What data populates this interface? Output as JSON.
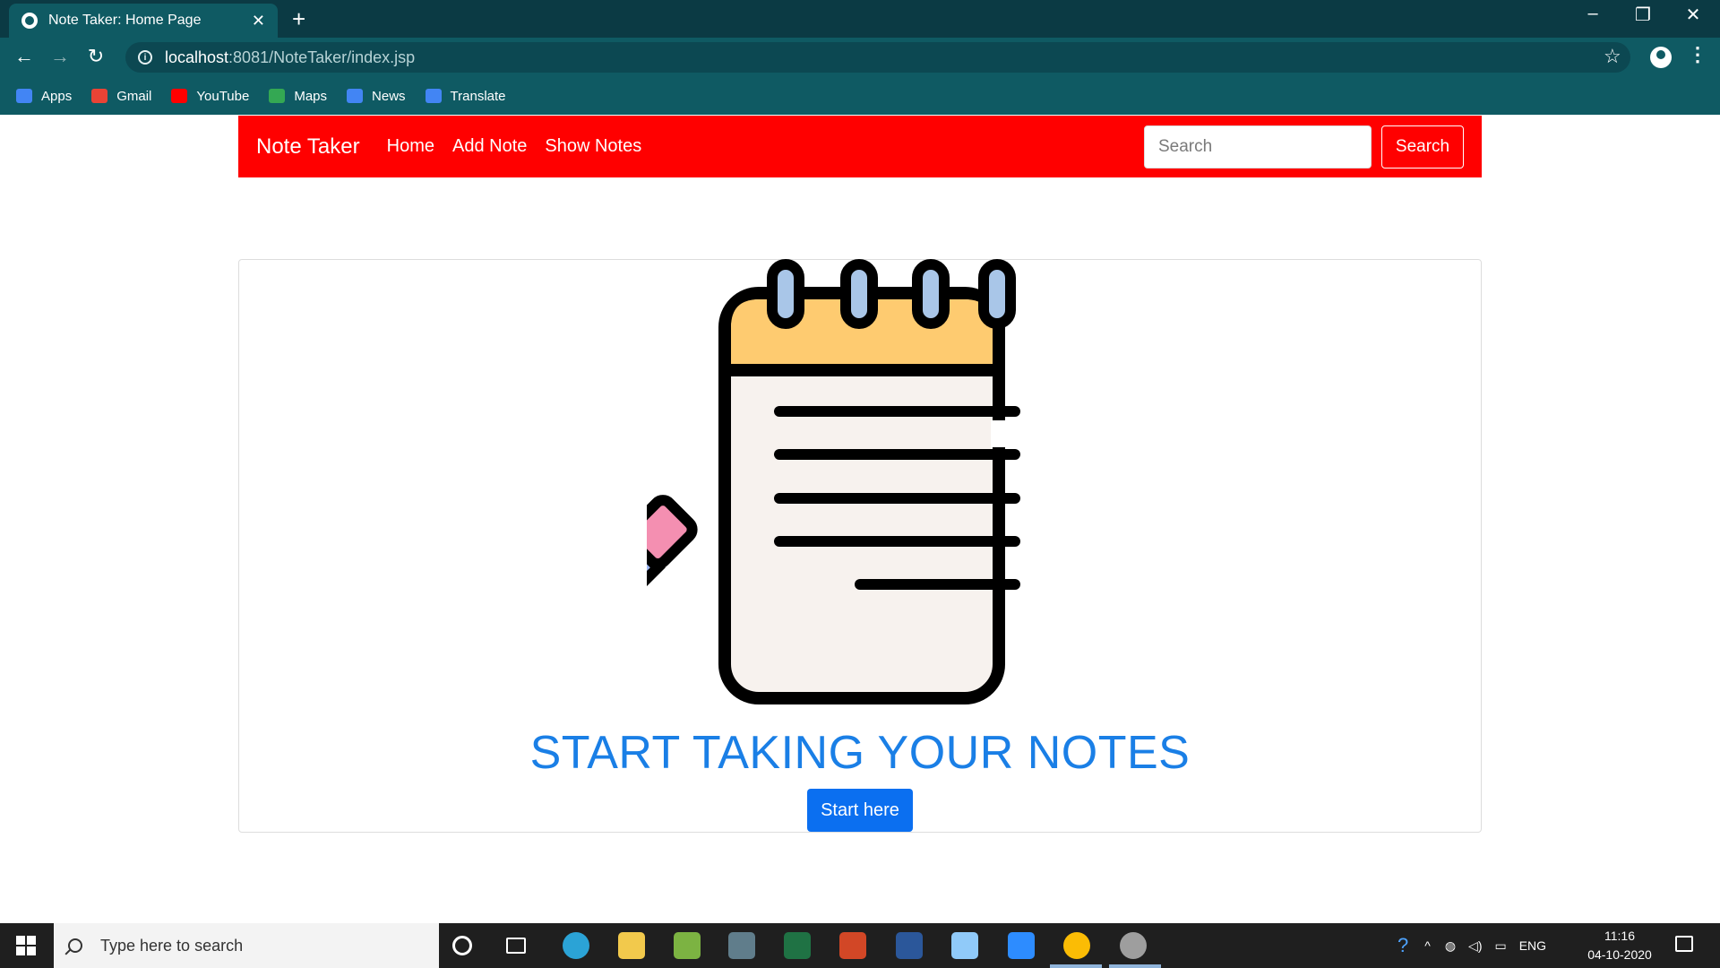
{
  "browser": {
    "tab_title": "Note Taker: Home Page",
    "tab_close": "✕",
    "new_tab": "+",
    "url_host": "localhost",
    "url_path": ":8081/NoteTaker/index.jsp",
    "window_controls": {
      "minimize": "–",
      "restore": "❐",
      "close": "✕"
    },
    "bookmarks": [
      {
        "label": "Apps",
        "icon": "apps-grid-icon",
        "color": "#4285f4"
      },
      {
        "label": "Gmail",
        "icon": "gmail-icon",
        "color": "#ea4335"
      },
      {
        "label": "YouTube",
        "icon": "youtube-icon",
        "color": "#ff0000"
      },
      {
        "label": "Maps",
        "icon": "maps-icon",
        "color": "#34a853"
      },
      {
        "label": "News",
        "icon": "news-icon",
        "color": "#4285f4"
      },
      {
        "label": "Translate",
        "icon": "translate-icon",
        "color": "#4285f4"
      }
    ]
  },
  "navbar": {
    "brand": "Note Taker",
    "links": [
      "Home",
      "Add Note",
      "Show Notes"
    ],
    "search_placeholder": "Search",
    "search_button": "Search",
    "color": "#ff0000"
  },
  "hero": {
    "heading": "START TAKING YOUR NOTES",
    "button": "Start here",
    "heading_color": "#1a7fe6",
    "button_color": "#0b6ff0"
  },
  "taskbar": {
    "search_placeholder": "Type here to search",
    "apps": [
      {
        "icon": "cortana-icon",
        "color": "#1f1f1f"
      },
      {
        "icon": "task-view-icon",
        "color": "#1f1f1f"
      },
      {
        "icon": "edge-icon",
        "color": "#2ba3d6"
      },
      {
        "icon": "file-explorer-icon",
        "color": "#f2c94c"
      },
      {
        "icon": "photo-app-icon",
        "color": "#7cb342"
      },
      {
        "icon": "app-icon",
        "color": "#607d8b"
      },
      {
        "icon": "excel-icon",
        "color": "#1f7244"
      },
      {
        "icon": "powerpoint-icon",
        "color": "#d24726"
      },
      {
        "icon": "word-icon",
        "color": "#2b579a"
      },
      {
        "icon": "paint-icon",
        "color": "#90caf9"
      },
      {
        "icon": "zoom-icon",
        "color": "#2d8cff"
      },
      {
        "icon": "chrome-icon",
        "color": "#fbbc05"
      },
      {
        "icon": "settings-app-icon",
        "color": "#9e9e9e"
      }
    ],
    "language": "ENG",
    "time": "11:16",
    "date": "04-10-2020"
  }
}
